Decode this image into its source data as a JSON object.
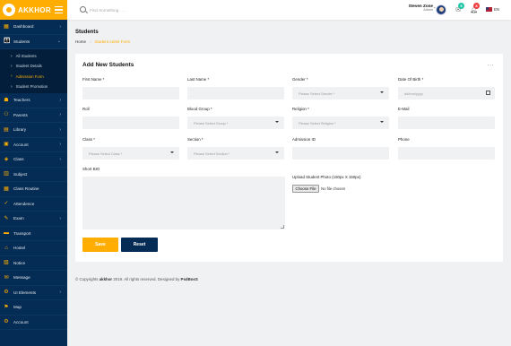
{
  "brand": {
    "name": "AKKHOR"
  },
  "sidebar": {
    "items": [
      {
        "label": "Dashboard",
        "icon": "dashboard-icon",
        "glyph": "▦",
        "arrow": true
      },
      {
        "label": "Students",
        "icon": "students-icon",
        "glyph": "👪",
        "arrow": true,
        "open": true,
        "children": [
          {
            "label": "All Students",
            "active": false
          },
          {
            "label": "Student Details",
            "active": false
          },
          {
            "label": "Admission Form",
            "active": true
          },
          {
            "label": "Student Promotion",
            "active": false
          }
        ]
      },
      {
        "label": "Teachers",
        "icon": "teachers-icon",
        "glyph": "☗",
        "arrow": true
      },
      {
        "label": "Parents",
        "icon": "parents-icon",
        "glyph": "⚇",
        "arrow": true
      },
      {
        "label": "Library",
        "icon": "library-icon",
        "glyph": "▤",
        "arrow": true
      },
      {
        "label": "Account",
        "icon": "account-icon",
        "glyph": "▣",
        "arrow": true
      },
      {
        "label": "Class",
        "icon": "class-icon",
        "glyph": "◈",
        "arrow": true
      },
      {
        "label": "Subject",
        "icon": "subject-icon",
        "glyph": "▥",
        "arrow": false
      },
      {
        "label": "Class Routine",
        "icon": "routine-icon",
        "glyph": "▦",
        "arrow": false
      },
      {
        "label": "Attendence",
        "icon": "attendance-icon",
        "glyph": "✓",
        "arrow": false
      },
      {
        "label": "Exam",
        "icon": "exam-icon",
        "glyph": "✎",
        "arrow": true
      },
      {
        "label": "Transport",
        "icon": "transport-icon",
        "glyph": "▬",
        "arrow": false
      },
      {
        "label": "Hostel",
        "icon": "hostel-icon",
        "glyph": "⌂",
        "arrow": false
      },
      {
        "label": "Notice",
        "icon": "notice-icon",
        "glyph": "▧",
        "arrow": false
      },
      {
        "label": "Message",
        "icon": "message-icon",
        "glyph": "✉",
        "arrow": false
      },
      {
        "label": "UI Elements",
        "icon": "ui-elements-icon",
        "glyph": "⚙",
        "arrow": true
      },
      {
        "label": "Map",
        "icon": "map-icon",
        "glyph": "⚑",
        "arrow": false
      },
      {
        "label": "Account",
        "icon": "account-settings-icon",
        "glyph": "⚙",
        "arrow": false
      }
    ]
  },
  "header": {
    "search_placeholder": "Find Something . . .",
    "user_name": "Steven Zone",
    "user_role": "Admin",
    "messages_badge": "5",
    "notifications_badge": "8",
    "language": "EN",
    "colors": {
      "messages_badge": "#1fc5a6",
      "notifications_badge": "#f03d3d"
    }
  },
  "page": {
    "title": "Students",
    "breadcrumb_home": "Home",
    "breadcrumb_current": "Student Admit Form"
  },
  "form": {
    "title": "Add New Students",
    "menu": "...",
    "fields": {
      "first_name": {
        "label": "First Name *",
        "value": ""
      },
      "last_name": {
        "label": "Last Name *",
        "value": ""
      },
      "gender": {
        "label": "Gender *",
        "value": "Please Select Gender *"
      },
      "dob": {
        "label": "Date Of Birth *",
        "value": "dd/mm/yyyy"
      },
      "roll": {
        "label": "Roll",
        "value": ""
      },
      "blood_group": {
        "label": "Blood Group *",
        "value": "Please Select Group *"
      },
      "religion": {
        "label": "Religion *",
        "value": "Please Select Religion *"
      },
      "email": {
        "label": "E-Mail",
        "value": ""
      },
      "class": {
        "label": "Class *",
        "value": "Please Select Class *"
      },
      "section": {
        "label": "Section *",
        "value": "Please Select Section *"
      },
      "admission_id": {
        "label": "Admission ID",
        "value": ""
      },
      "phone": {
        "label": "Phone",
        "value": ""
      },
      "short_bio": {
        "label": "Short BIO",
        "value": ""
      },
      "photo": {
        "label": "Upload Student Photo (150px X 150px)",
        "button": "Choose File",
        "status": "No file chosen"
      }
    },
    "save_label": "Save",
    "reset_label": "Reset"
  },
  "footer": {
    "prefix": "© Copyrights",
    "brand": "akkhor",
    "middle": "2019. All rights reserved. Designed by",
    "designer": "PsdBosS"
  },
  "colors": {
    "primary": "#ffae01",
    "sidebar": "#042c54",
    "field_bg": "#f0f1f3"
  }
}
